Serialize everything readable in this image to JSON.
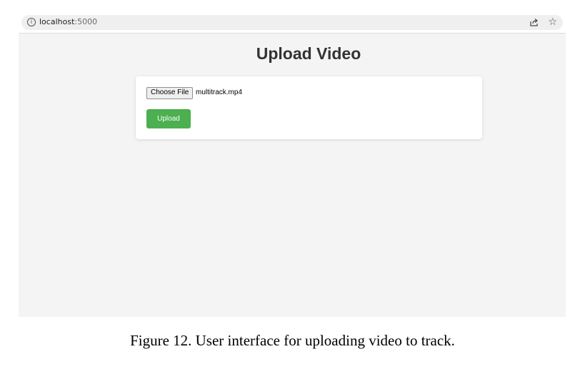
{
  "browser": {
    "url_host": "localhost",
    "url_port": ":5000",
    "info_icon": "info-icon",
    "share_icon": "share-icon",
    "bookmark_icon": "star-icon"
  },
  "page": {
    "title": "Upload Video"
  },
  "upload_form": {
    "choose_file_label": "Choose File",
    "selected_file": "multitrack.mp4",
    "upload_label": "Upload",
    "upload_color": "#4caf50"
  },
  "caption": "Figure 12. User interface for uploading video to track."
}
